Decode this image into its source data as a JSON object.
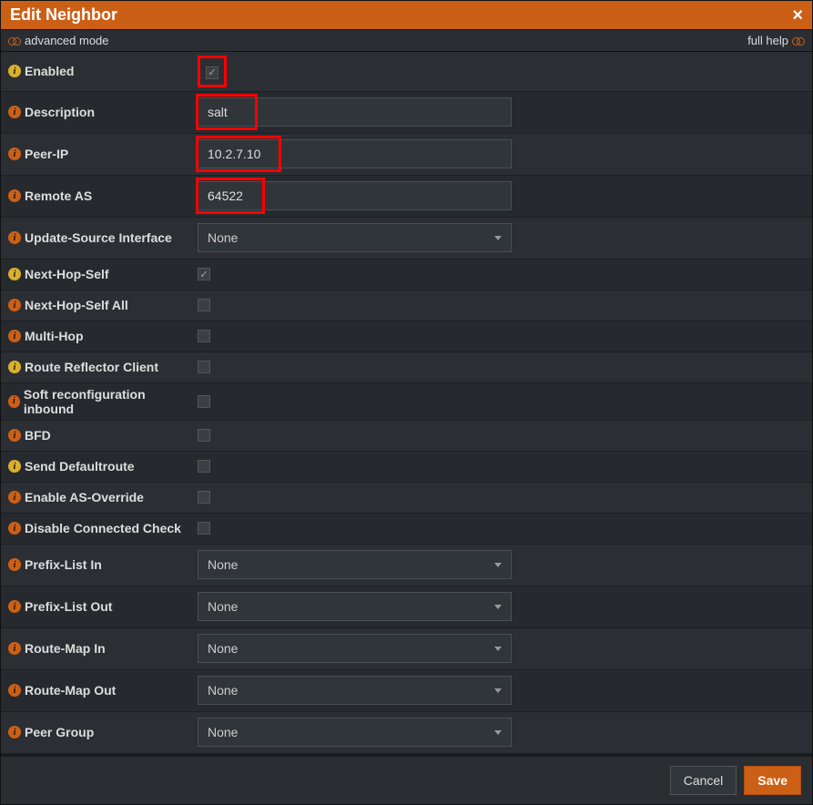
{
  "titlebar": {
    "title": "Edit Neighbor"
  },
  "toolbar": {
    "advanced": "advanced mode",
    "fullhelp": "full help"
  },
  "fields": {
    "enabled": "Enabled",
    "description": "Description",
    "peerip": "Peer-IP",
    "remoteas": "Remote AS",
    "updatesource": "Update-Source Interface",
    "nexthopself": "Next-Hop-Self",
    "nexthopselfall": "Next-Hop-Self All",
    "multihop": "Multi-Hop",
    "rrclient": "Route Reflector Client",
    "softreconf": "Soft reconfiguration inbound",
    "bfd": "BFD",
    "senddefault": "Send Defaultroute",
    "asoverride": "Enable AS-Override",
    "disableconn": "Disable Connected Check",
    "prefixin": "Prefix-List In",
    "prefixout": "Prefix-List Out",
    "routemapin": "Route-Map In",
    "routemapout": "Route-Map Out",
    "peergroup": "Peer Group"
  },
  "values": {
    "description": "salt",
    "peerip": "10.2.7.10",
    "remoteas": "64522"
  },
  "selects": {
    "updatesource": "None",
    "prefixin": "None",
    "prefixout": "None",
    "routemapin": "None",
    "routemapout": "None",
    "peergroup": "None"
  },
  "buttons": {
    "cancel": "Cancel",
    "save": "Save"
  }
}
